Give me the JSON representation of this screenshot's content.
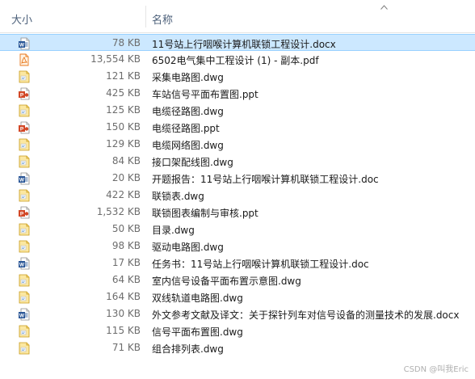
{
  "header": {
    "size_label": "大小",
    "name_label": "名称"
  },
  "files": [
    {
      "size": "78 KB",
      "name": "11号站上行咽喉计算机联锁工程设计.docx",
      "type": "docx",
      "selected": true
    },
    {
      "size": "13,554 KB",
      "name": "6502电气集中工程设计 (1) - 副本.pdf",
      "type": "pdf",
      "selected": false
    },
    {
      "size": "121 KB",
      "name": "采集电路图.dwg",
      "type": "dwg",
      "selected": false
    },
    {
      "size": "425 KB",
      "name": "车站信号平面布置图.ppt",
      "type": "ppt",
      "selected": false
    },
    {
      "size": "125 KB",
      "name": "电缆径路图.dwg",
      "type": "dwg",
      "selected": false
    },
    {
      "size": "150 KB",
      "name": "电缆径路图.ppt",
      "type": "ppt",
      "selected": false
    },
    {
      "size": "129 KB",
      "name": "电缆网络图.dwg",
      "type": "dwg",
      "selected": false
    },
    {
      "size": "84 KB",
      "name": "接口架配线图.dwg",
      "type": "dwg",
      "selected": false
    },
    {
      "size": "20 KB",
      "name": "开题报告：11号站上行咽喉计算机联锁工程设计.doc",
      "type": "docx",
      "selected": false
    },
    {
      "size": "422 KB",
      "name": "联锁表.dwg",
      "type": "dwg",
      "selected": false
    },
    {
      "size": "1,532 KB",
      "name": "联锁图表编制与审核.ppt",
      "type": "ppt",
      "selected": false
    },
    {
      "size": "50 KB",
      "name": "目录.dwg",
      "type": "dwg",
      "selected": false
    },
    {
      "size": "98 KB",
      "name": "驱动电路图.dwg",
      "type": "dwg",
      "selected": false
    },
    {
      "size": "17 KB",
      "name": "任务书：11号站上行咽喉计算机联锁工程设计.doc",
      "type": "docx",
      "selected": false
    },
    {
      "size": "64 KB",
      "name": "室内信号设备平面布置示意图.dwg",
      "type": "dwg",
      "selected": false
    },
    {
      "size": "164 KB",
      "name": "双线轨道电路图.dwg",
      "type": "dwg",
      "selected": false
    },
    {
      "size": "130 KB",
      "name": "外文参考文献及译文：关于探针列车对信号设备的测量技术的发展.docx",
      "type": "docx",
      "selected": false
    },
    {
      "size": "115 KB",
      "name": "信号平面布置图.dwg",
      "type": "dwg",
      "selected": false
    },
    {
      "size": "71 KB",
      "name": "组合排列表.dwg",
      "type": "dwg",
      "selected": false
    }
  ],
  "watermark": "CSDN @叫我Eric",
  "colors": {
    "selected_bg": "#cce8ff",
    "word_blue": "#2b5797",
    "pdf_orange": "#e8771c",
    "ppt_red": "#d24726",
    "dwg_yellow": "#f6d365"
  }
}
